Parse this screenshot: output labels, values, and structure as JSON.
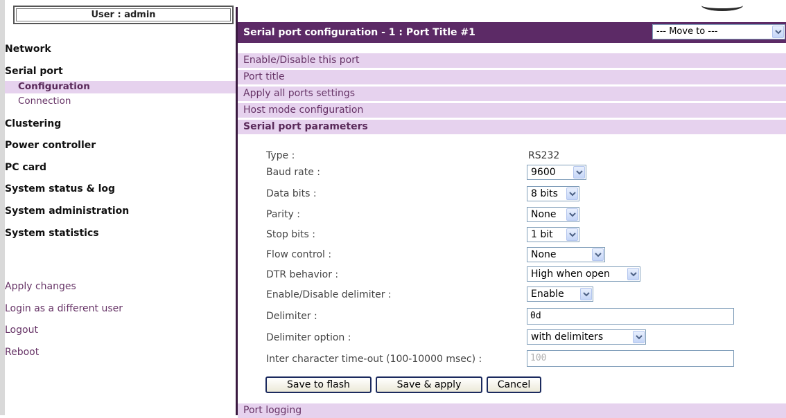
{
  "sidebar": {
    "user_label": "User : admin",
    "nav": [
      {
        "label": "Network"
      },
      {
        "label": "Serial port"
      },
      {
        "label": "Clustering"
      },
      {
        "label": "Power controller"
      },
      {
        "label": "PC card"
      },
      {
        "label": "System status & log"
      },
      {
        "label": "System administration"
      },
      {
        "label": "System statistics"
      }
    ],
    "serial_sub": [
      {
        "label": "Configuration",
        "active": true
      },
      {
        "label": "Connection",
        "active": false
      }
    ],
    "actions": [
      {
        "label": "Apply changes"
      },
      {
        "label": "Login as a different user"
      },
      {
        "label": "Logout"
      },
      {
        "label": "Reboot"
      }
    ]
  },
  "header": {
    "title": "Serial port configuration - 1 : Port Title #1",
    "move_to": "--- Move to ---"
  },
  "sections": [
    {
      "label": "Enable/Disable this port"
    },
    {
      "label": "Port title"
    },
    {
      "label": "Apply all ports settings"
    },
    {
      "label": "Host mode configuration"
    },
    {
      "label": "Serial port parameters"
    }
  ],
  "form": {
    "type": {
      "label": "Type :",
      "value": "RS232"
    },
    "baud_rate": {
      "label": "Baud rate :",
      "value": "9600"
    },
    "data_bits": {
      "label": "Data bits :",
      "value": "8 bits"
    },
    "parity": {
      "label": "Parity :",
      "value": "None"
    },
    "stop_bits": {
      "label": "Stop bits :",
      "value": "1 bit"
    },
    "flow_control": {
      "label": "Flow control :",
      "value": "None"
    },
    "dtr": {
      "label": "DTR behavior :",
      "value": "High when open"
    },
    "delim_enable": {
      "label": "Enable/Disable delimiter :",
      "value": "Enable"
    },
    "delimiter": {
      "label": "Delimiter :",
      "value": "0d"
    },
    "delim_option": {
      "label": "Delimiter option :",
      "value": "with delimiters"
    },
    "inter_char": {
      "label": "Inter character time-out (100-10000 msec) :",
      "value": "100"
    }
  },
  "buttons": {
    "save_flash": "Save to flash",
    "save_apply": "Save & apply",
    "cancel": "Cancel"
  },
  "footer_section": {
    "label": "Port logging"
  },
  "colors": {
    "header_bg": "#5c2a66",
    "section_bg": "#e6d2ee",
    "link": "#663366"
  }
}
